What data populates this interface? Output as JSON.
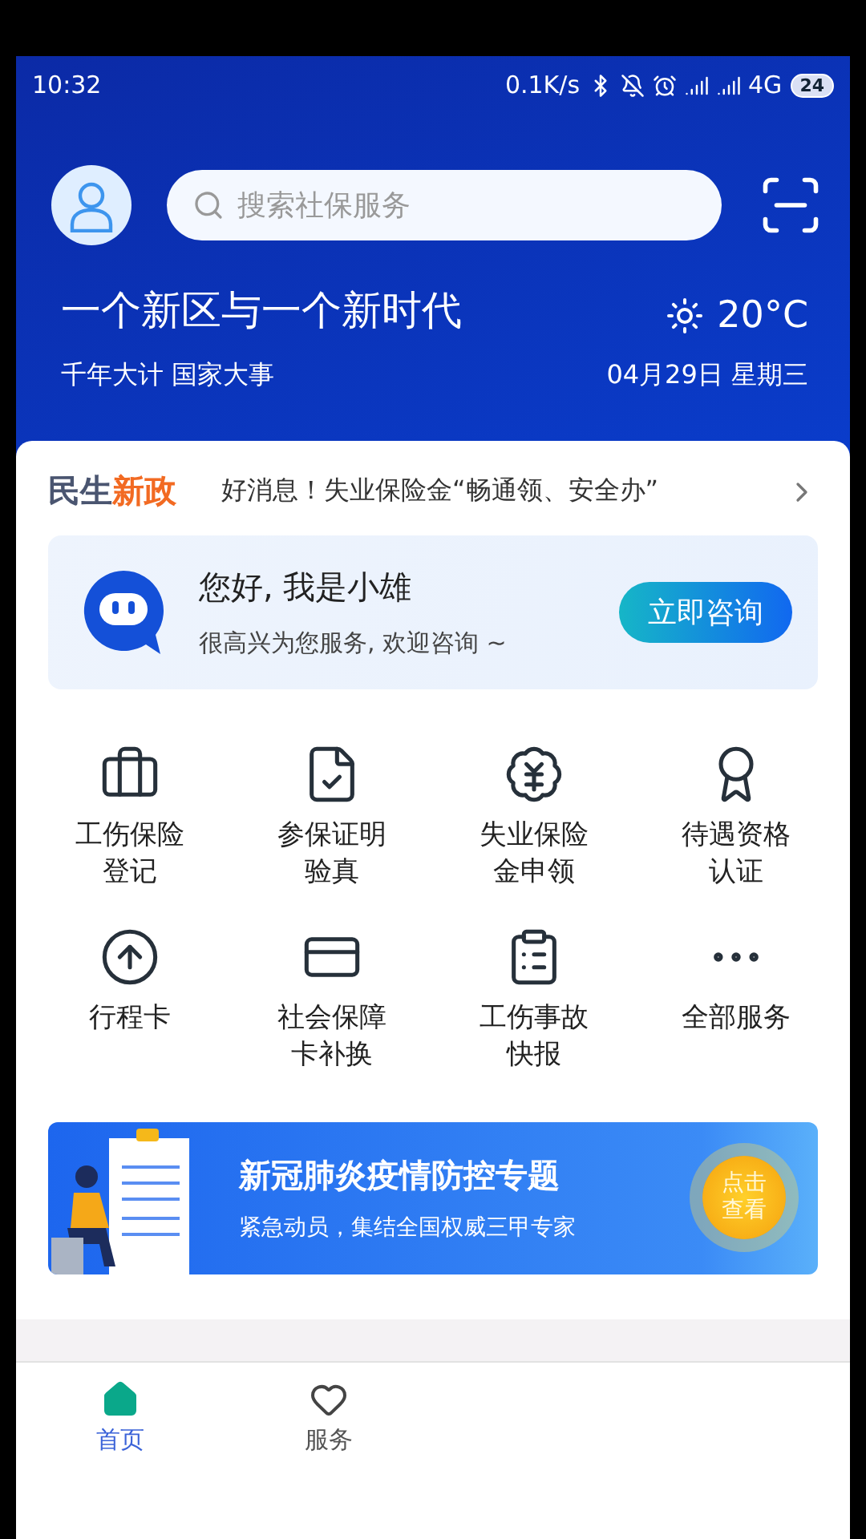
{
  "status_bar": {
    "time": "10:32",
    "speed": "0.1K/s",
    "network": "4G",
    "battery": "24"
  },
  "header": {
    "search": {
      "placeholder": "搜索社保服务"
    },
    "headline": "一个新区与一个新时代",
    "subline": "千年大计 国家大事",
    "weather": {
      "temperature": "20°C",
      "date": "04月29日 星期三"
    }
  },
  "news": {
    "brand_first": "民生",
    "brand_second": "新政",
    "text": "好消息！失业保险金“畅通领、安全办”"
  },
  "assistant": {
    "title": "您好, 我是小雄",
    "subtitle": "很高兴为您服务, 欢迎咨询 ~",
    "button": "立即咨询"
  },
  "services": [
    {
      "label": "工伤保险登记"
    },
    {
      "label": "参保证明验真"
    },
    {
      "label": "失业保险金申领"
    },
    {
      "label": "待遇资格认证"
    },
    {
      "label": "行程卡"
    },
    {
      "label": "社会保障卡补换"
    },
    {
      "label": "工伤事故快报"
    },
    {
      "label": "全部服务"
    }
  ],
  "banner": {
    "title": "新冠肺炎疫情防控专题",
    "subtitle": "紧急动员，集结全国权威三甲专家",
    "button": "点击查看"
  },
  "bottom_nav": [
    {
      "label": "首页",
      "selected": true
    },
    {
      "label": "服务",
      "selected": false
    }
  ]
}
